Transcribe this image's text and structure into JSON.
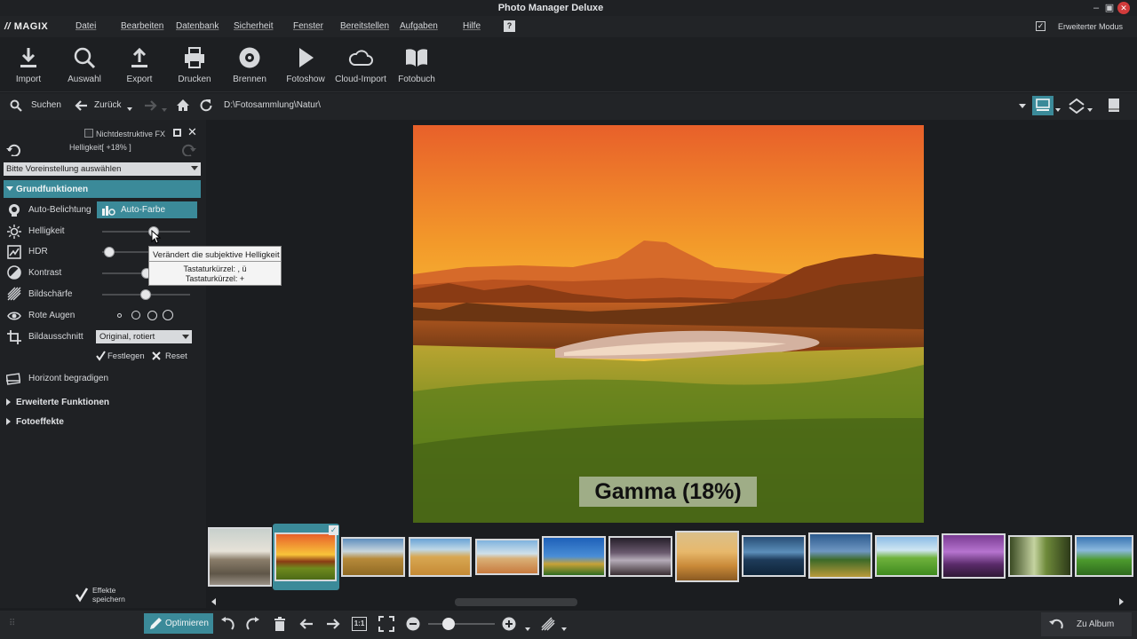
{
  "window": {
    "title": "Photo Manager Deluxe"
  },
  "menu": {
    "logo": "MAGIX",
    "items": [
      "Datei",
      "Bearbeiten",
      "Datenbank",
      "Sicherheit",
      "Fenster",
      "Bereitstellen",
      "Aufgaben",
      "Hilfe"
    ],
    "advanced_mode": "Erweiterter Modus"
  },
  "toolbar": {
    "items": [
      "Import",
      "Auswahl",
      "Export",
      "Drucken",
      "Brennen",
      "Fotoshow",
      "Cloud-Import",
      "Fotobuch"
    ]
  },
  "nav": {
    "search": "Suchen",
    "back": "Zurück",
    "path": "D:\\Fotosammlung\\Natur\\"
  },
  "panel": {
    "nondestructive_label": "Nichtdestruktive FX",
    "current_action": "Helligkeit[ +18% ]",
    "preset_placeholder": "Bitte Voreinstellung auswählen",
    "section_basic": "Grundfunktionen",
    "auto_exposure": "Auto-Belichtung",
    "auto_color": "Auto-Farbe",
    "brightness": "Helligkeit",
    "hdr": "HDR",
    "contrast": "Kontrast",
    "sharpness": "Bildschärfe",
    "red_eye": "Rote Augen",
    "crop": "Bildausschnitt",
    "crop_value": "Original, rotiert",
    "apply": "Festlegen",
    "reset": "Reset",
    "straighten": "Horizont begradigen",
    "section_advanced": "Erweiterte Funktionen",
    "section_effects": "Fotoeffekte",
    "save_effects_line1": "Effekte",
    "save_effects_line2": "speichern"
  },
  "tooltip": {
    "title": "Verändert die subjektive Helligkeit",
    "shortcut1": "Tastaturkürzel: , ü",
    "shortcut2": "Tastaturkürzel: +"
  },
  "photo": {
    "overlay": "Gamma (18%)"
  },
  "bottom": {
    "optimize": "Optimieren",
    "one_to_one": "1:1",
    "to_album": "Zu Album"
  },
  "colors": {
    "accent": "#3b8a99",
    "background": "#1b1d20",
    "panel": "#1f2124"
  }
}
